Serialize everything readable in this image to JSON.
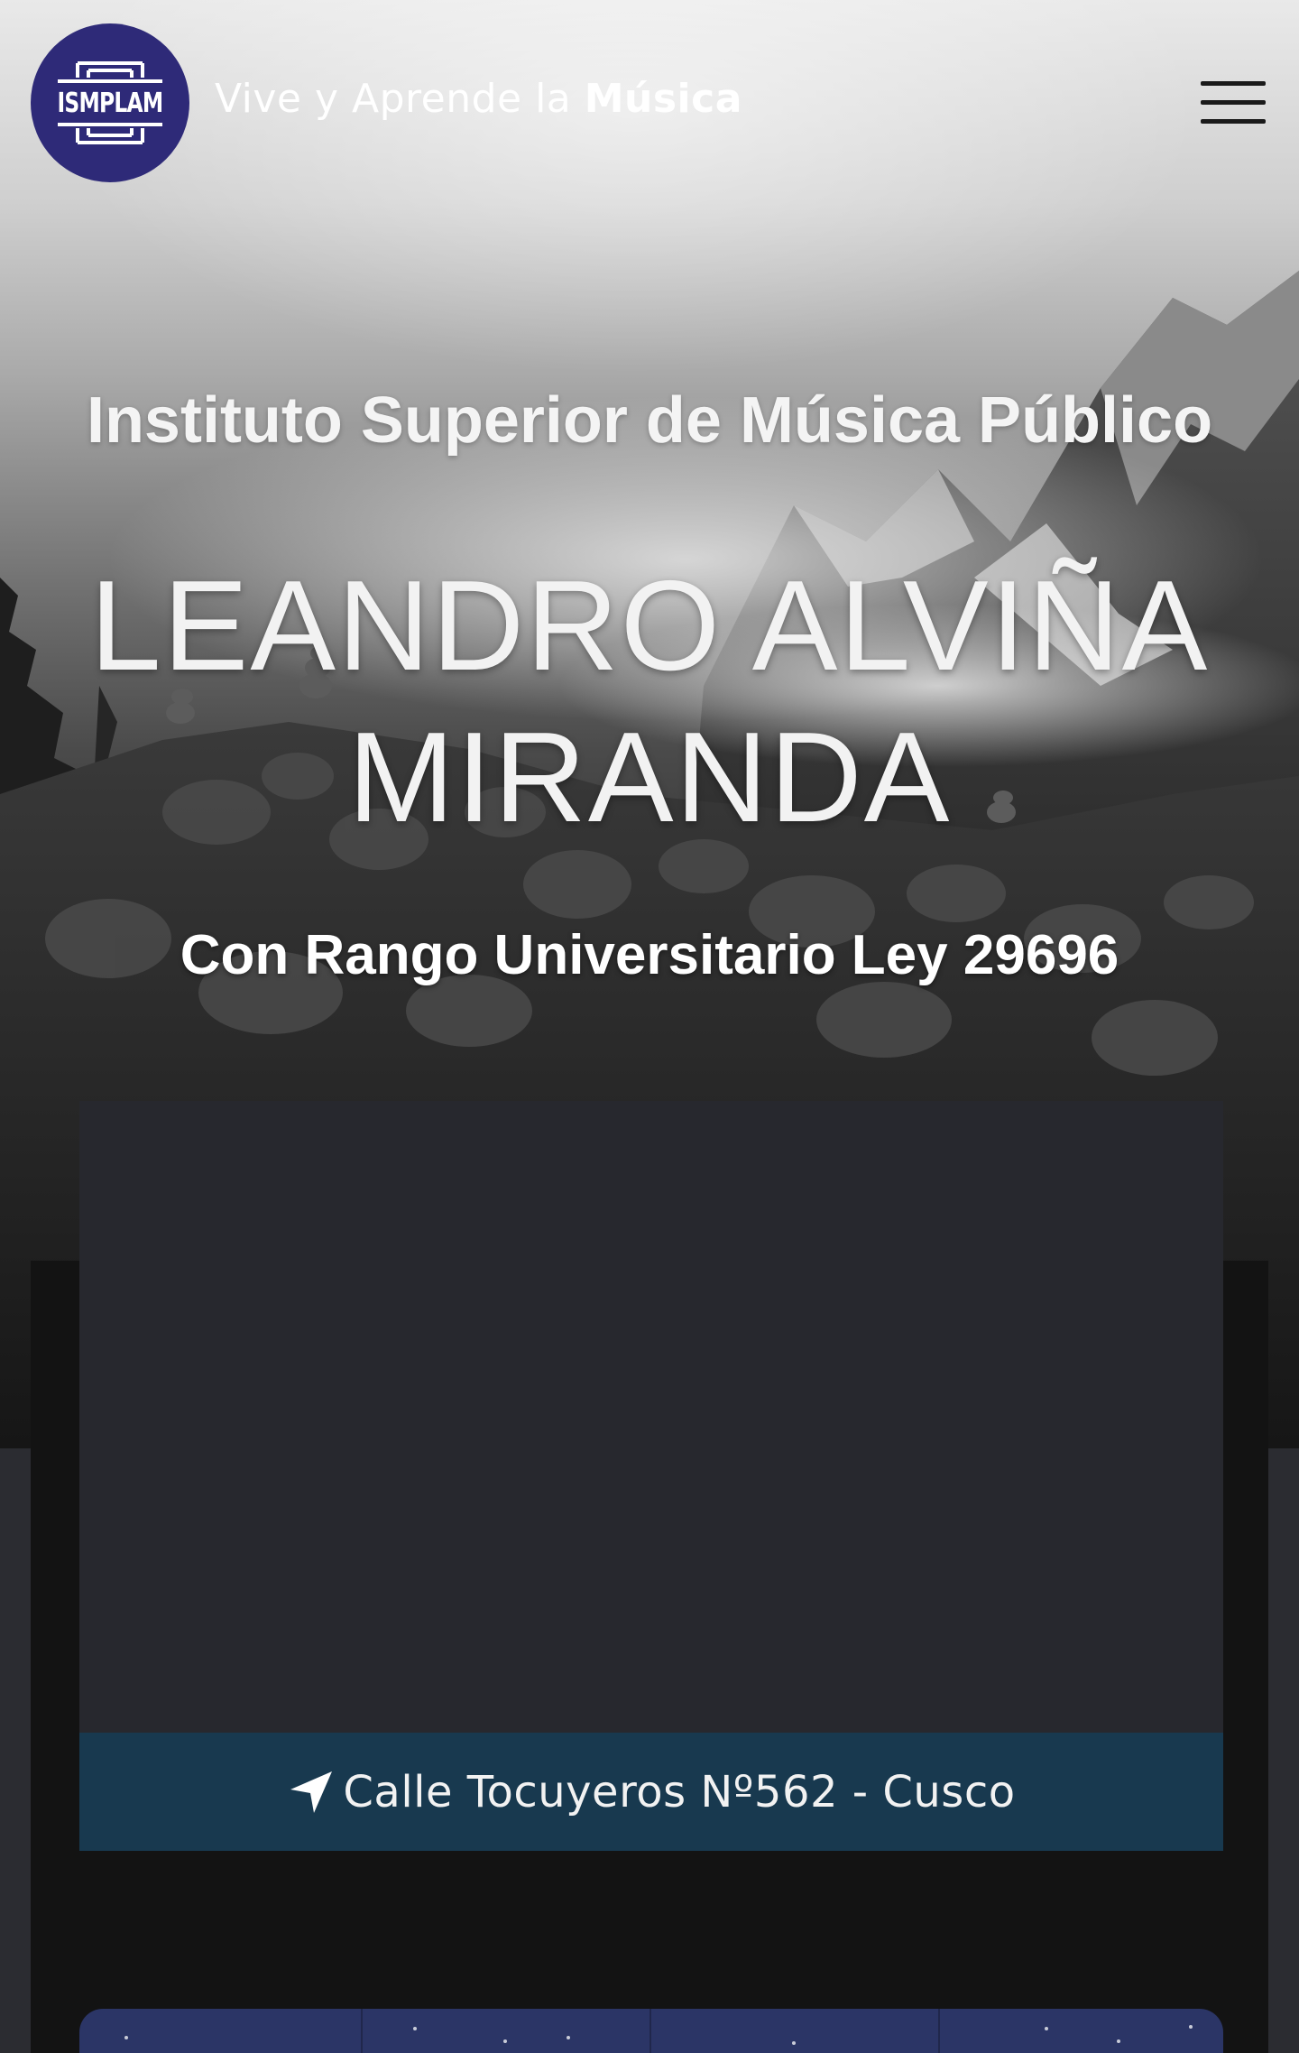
{
  "header": {
    "logo_text": "ISMPLAM",
    "tagline_regular": "Vive y Aprende la ",
    "tagline_bold": "Música",
    "menu_icon": "hamburger-menu-icon"
  },
  "hero": {
    "institute": "Instituto Superior de Música Público",
    "name_line1": "LEANDRO ALVIÑA",
    "name_line2": "MIRANDA",
    "rank": "Con Rango Universitario Ley 29696"
  },
  "location": {
    "icon": "location-arrow-icon",
    "address": "Calle Tocuyeros Nº562 - Cusco"
  },
  "colors": {
    "logo_bg": "#2e2a78",
    "address_bar": "#18394f",
    "map_card": "#27282e",
    "panel": "#131313",
    "next_card": "#2b3566"
  }
}
